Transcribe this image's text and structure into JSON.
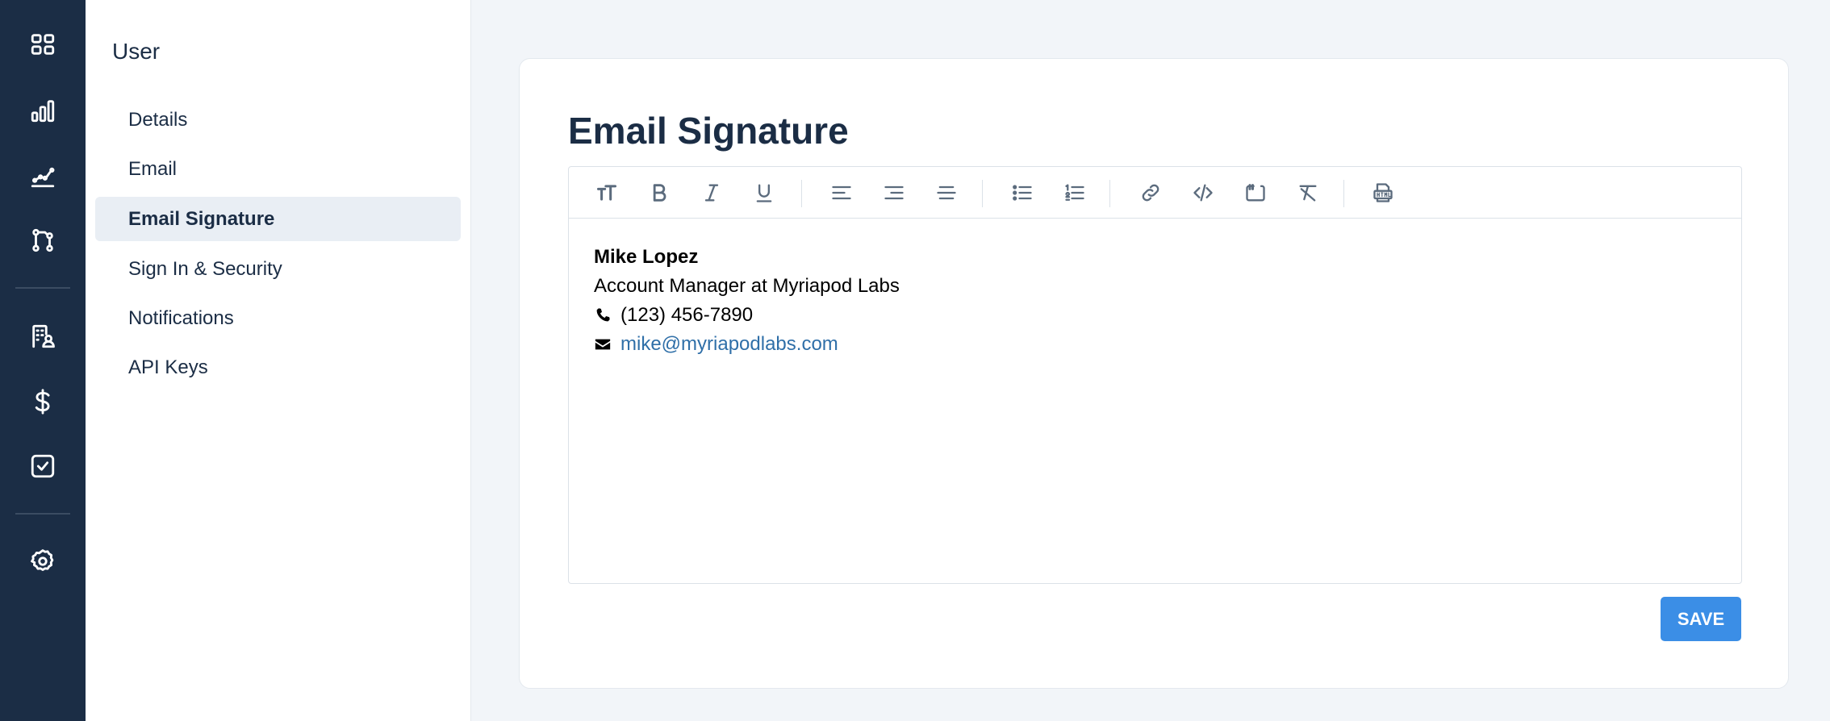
{
  "rail": {
    "items": [
      {
        "icon": "grid-icon"
      },
      {
        "icon": "bar-chart-icon"
      },
      {
        "icon": "line-chart-icon"
      },
      {
        "icon": "pipeline-icon"
      },
      {
        "icon": "building-user-icon"
      },
      {
        "icon": "dollar-icon"
      },
      {
        "icon": "checkbox-icon"
      },
      {
        "icon": "gear-icon"
      }
    ]
  },
  "subnav": {
    "title": "User",
    "items": [
      {
        "label": "Details",
        "active": false
      },
      {
        "label": "Email",
        "active": false
      },
      {
        "label": "Email Signature",
        "active": true
      },
      {
        "label": "Sign In & Security",
        "active": false
      },
      {
        "label": "Notifications",
        "active": false
      },
      {
        "label": "API Keys",
        "active": false
      }
    ]
  },
  "main": {
    "title": "Email Signature",
    "toolbar": [
      "font-size-icon",
      "bold-icon",
      "italic-icon",
      "underline-icon",
      "align-left-icon",
      "align-right-icon",
      "align-center-icon",
      "bullet-list-icon",
      "numbered-list-icon",
      "link-icon",
      "code-icon",
      "quote-icon",
      "clear-format-icon",
      "html-icon"
    ],
    "signature": {
      "name": "Mike Lopez",
      "role": "Account Manager at Myriapod Labs",
      "phone": "(123) 456-7890",
      "email": "mike@myriapodlabs.com"
    },
    "save_label": "SAVE"
  },
  "colors": {
    "rail_bg": "#1b2d45",
    "accent": "#3b8ee6",
    "link": "#2f6fa8",
    "page_bg": "#f2f5f9"
  }
}
